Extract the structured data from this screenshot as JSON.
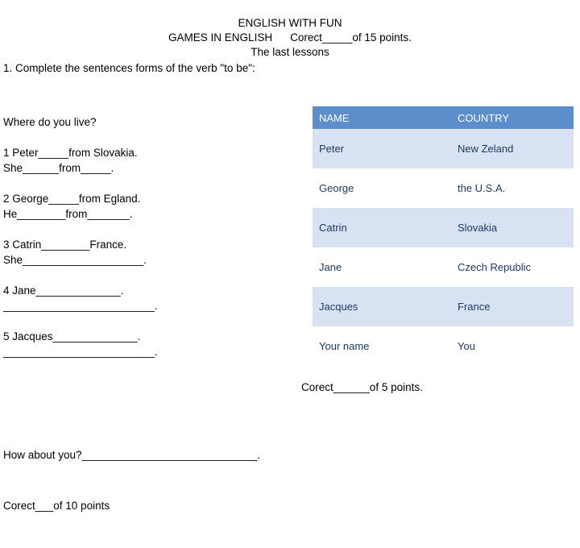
{
  "header": {
    "title": "ENGLISH WITH FUN",
    "subtitle_left": "GAMES IN ENGLISH",
    "subtitle_right": "Corect_____of 15 points.",
    "line3": "The last lessons"
  },
  "task": {
    "instruction": "1. Complete the sentences forms of the verb \"to be\":"
  },
  "questions": {
    "prompt": "Where do you live?",
    "items": [
      {
        "line1": "1 Peter_____from Slovakia.",
        "line2": "She______from_____."
      },
      {
        "line1": "2 George_____from Egland.",
        "line2": "He________from_______."
      },
      {
        "line1": "3 Catrin________France.",
        "line2": "She____________________."
      },
      {
        "line1": "4 Jane______________.",
        "line2": "_________________________."
      },
      {
        "line1": "5 Jacques______________.",
        "line2": "_________________________."
      }
    ]
  },
  "table": {
    "headers": [
      "NAME",
      "COUNTRY"
    ],
    "rows": [
      [
        "Peter",
        "New Zeland"
      ],
      [
        "George",
        "the U.S.A."
      ],
      [
        "Catrin",
        "Slovakia"
      ],
      [
        "Jane",
        "Czech Republic"
      ],
      [
        "Jacques",
        "France"
      ],
      [
        "Your name",
        "You"
      ]
    ],
    "score_note": "Corect______of 5 points."
  },
  "footer": {
    "line1": "How about you?_____________________________.",
    "line2": "Corect___of 10 points"
  },
  "colors": {
    "header_fill": "#5b8ecb",
    "row_shade": "#d9e2f3",
    "cell_text": "#1f3864"
  }
}
